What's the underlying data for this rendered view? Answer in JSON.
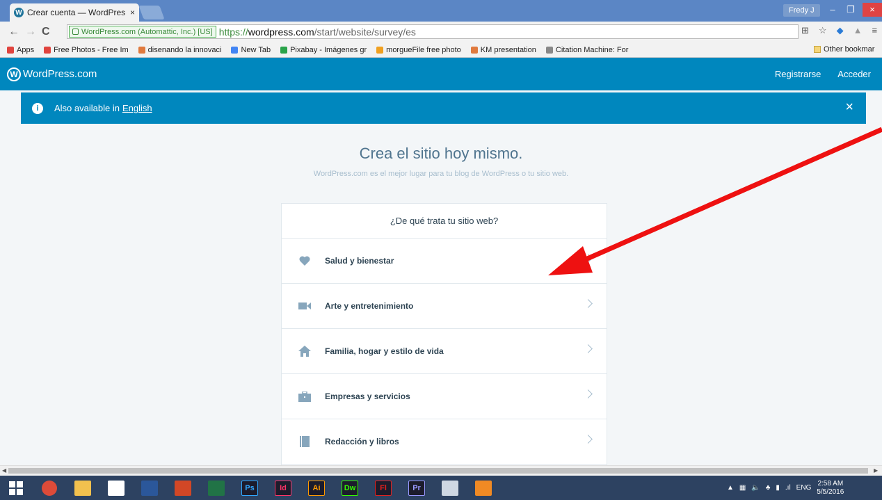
{
  "browser": {
    "tab_title": "Crear cuenta — WordPres",
    "tab_close": "×",
    "user": "Fredy J",
    "win_min": "–",
    "win_max": "❐",
    "win_close": "×",
    "back": "←",
    "forward": "→",
    "reload": "C",
    "secure_label": "WordPress.com (Automattic, Inc.) [US]",
    "url_scheme": "https://",
    "url_host": "wordpress.com",
    "url_path": "/start/website/survey/es",
    "bookmarks": [
      {
        "label": "Apps",
        "icon": "apps-grid-icon",
        "color": "#e0443e"
      },
      {
        "label": "Free Photos - Free Im",
        "icon": "f-icon",
        "color": "#e0443e"
      },
      {
        "label": "disenando la innovaci",
        "icon": "km-icon",
        "color": "#e07a3e"
      },
      {
        "label": "New Tab",
        "icon": "google-icon",
        "color": "#4285f4"
      },
      {
        "label": "Pixabay - Imágenes gr",
        "icon": "px-icon",
        "color": "#2aa34a"
      },
      {
        "label": "morgueFile free photo",
        "icon": "star-icon",
        "color": "#f0a020"
      },
      {
        "label": "KM presentation",
        "icon": "km-icon",
        "color": "#e07a3e"
      },
      {
        "label": "Citation Machine: For",
        "icon": "page-icon",
        "color": "#888888"
      }
    ],
    "other_bookmarks": "Other bookmar"
  },
  "wp": {
    "logo_text": "WordPress.com",
    "signup": "Registrarse",
    "login": "Acceder",
    "notice_text": "Also available in",
    "notice_link": "English",
    "notice_close": "×",
    "headline": "Crea el sitio hoy mismo.",
    "subline": "WordPress.com es el mejor lugar para tu blog de WordPress o tu sitio web.",
    "question": "¿De qué trata tu sitio web?",
    "options": [
      {
        "label": "Salud y bienestar",
        "icon": "heart-icon"
      },
      {
        "label": "Arte y entretenimiento",
        "icon": "video-camera-icon"
      },
      {
        "label": "Familia, hogar y estilo de vida",
        "icon": "house-icon"
      },
      {
        "label": "Empresas y servicios",
        "icon": "briefcase-icon"
      },
      {
        "label": "Redacción y libros",
        "icon": "book-icon"
      }
    ]
  },
  "taskbar": {
    "apps": [
      {
        "label": "",
        "icon": "chrome-icon",
        "color": "#dd4b39"
      },
      {
        "label": "",
        "icon": "file-explorer-icon",
        "color": "#f2c14e"
      },
      {
        "label": "",
        "icon": "home-icon",
        "color": "#ffffff"
      },
      {
        "label": "",
        "icon": "word-icon",
        "color": "#2b579a"
      },
      {
        "label": "",
        "icon": "powerpoint-icon",
        "color": "#d24726"
      },
      {
        "label": "",
        "icon": "excel-icon",
        "color": "#217346"
      },
      {
        "label": "Ps",
        "icon": "photoshop-icon",
        "color": "#31a8ff"
      },
      {
        "label": "Id",
        "icon": "indesign-icon",
        "color": "#ff3366"
      },
      {
        "label": "Ai",
        "icon": "illustrator-icon",
        "color": "#ff9a00"
      },
      {
        "label": "Dw",
        "icon": "dreamweaver-icon",
        "color": "#35fa00"
      },
      {
        "label": "Fl",
        "icon": "flash-icon",
        "color": "#e0201e"
      },
      {
        "label": "Pr",
        "icon": "premiere-icon",
        "color": "#9999ff"
      },
      {
        "label": "",
        "icon": "calculator-icon",
        "color": "#cfd8e3"
      },
      {
        "label": "",
        "icon": "media-player-icon",
        "color": "#f08a24"
      }
    ],
    "lang": "ENG",
    "time": "2:58 AM",
    "date": "5/5/2016"
  }
}
